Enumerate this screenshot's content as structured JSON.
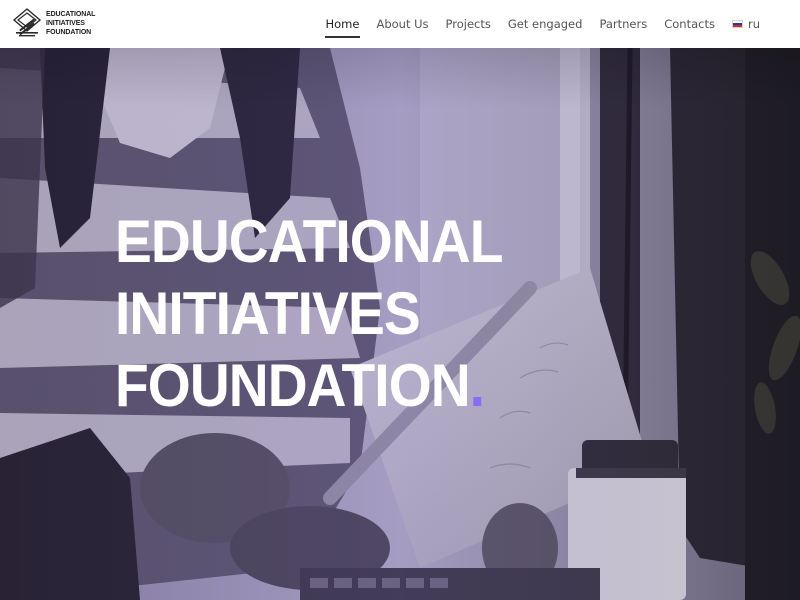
{
  "brand": {
    "lines": [
      "EDUCATIONAL",
      "INITIATIVES",
      "FOUNDATION"
    ]
  },
  "nav": {
    "items": [
      {
        "label": "Home",
        "active": true
      },
      {
        "label": "About Us",
        "active": false
      },
      {
        "label": "Projects",
        "active": false
      },
      {
        "label": "Get engaged",
        "active": false
      },
      {
        "label": "Partners",
        "active": false
      },
      {
        "label": "Contacts",
        "active": false
      }
    ],
    "language": {
      "label": "ru",
      "icon": "russia-flag-icon"
    }
  },
  "hero": {
    "title_lines": [
      "EDUCATIONAL",
      "INITIATIVES",
      "FOUNDATION"
    ],
    "title_dot": ".",
    "accent_color": "#8a6cf0"
  },
  "colors": {
    "header_bg": "#ffffff",
    "nav_text": "#555555",
    "hero_text": "#ffffff"
  }
}
